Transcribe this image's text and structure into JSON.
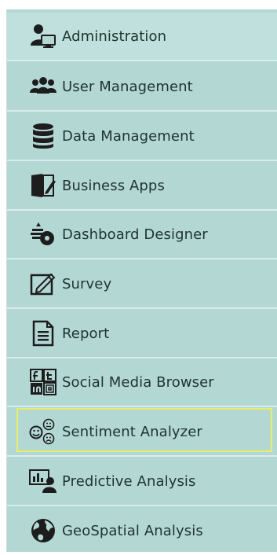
{
  "menu": {
    "items": [
      {
        "label": "Administration",
        "icon": "admin-user-monitor-icon"
      },
      {
        "label": "User Management",
        "icon": "users-group-icon"
      },
      {
        "label": "Data Management",
        "icon": "database-icon"
      },
      {
        "label": "Business Apps",
        "icon": "folder-apps-icon"
      },
      {
        "label": "Dashboard Designer",
        "icon": "dashboard-designer-icon"
      },
      {
        "label": "Survey",
        "icon": "survey-edit-icon"
      },
      {
        "label": "Report",
        "icon": "report-document-icon"
      },
      {
        "label": "Social Media Browser",
        "icon": "social-media-icon"
      },
      {
        "label": "Sentiment Analyzer",
        "icon": "sentiment-faces-icon",
        "selected": true
      },
      {
        "label": "Predictive Analysis",
        "icon": "predictive-analysis-icon"
      },
      {
        "label": "GeoSpatial Analysis",
        "icon": "globe-icon"
      }
    ]
  },
  "colors": {
    "menu_background": "#b3d8d4",
    "highlight_border": "#e8ef67",
    "text": "#1f3331",
    "icon": "#1f1f1f"
  }
}
